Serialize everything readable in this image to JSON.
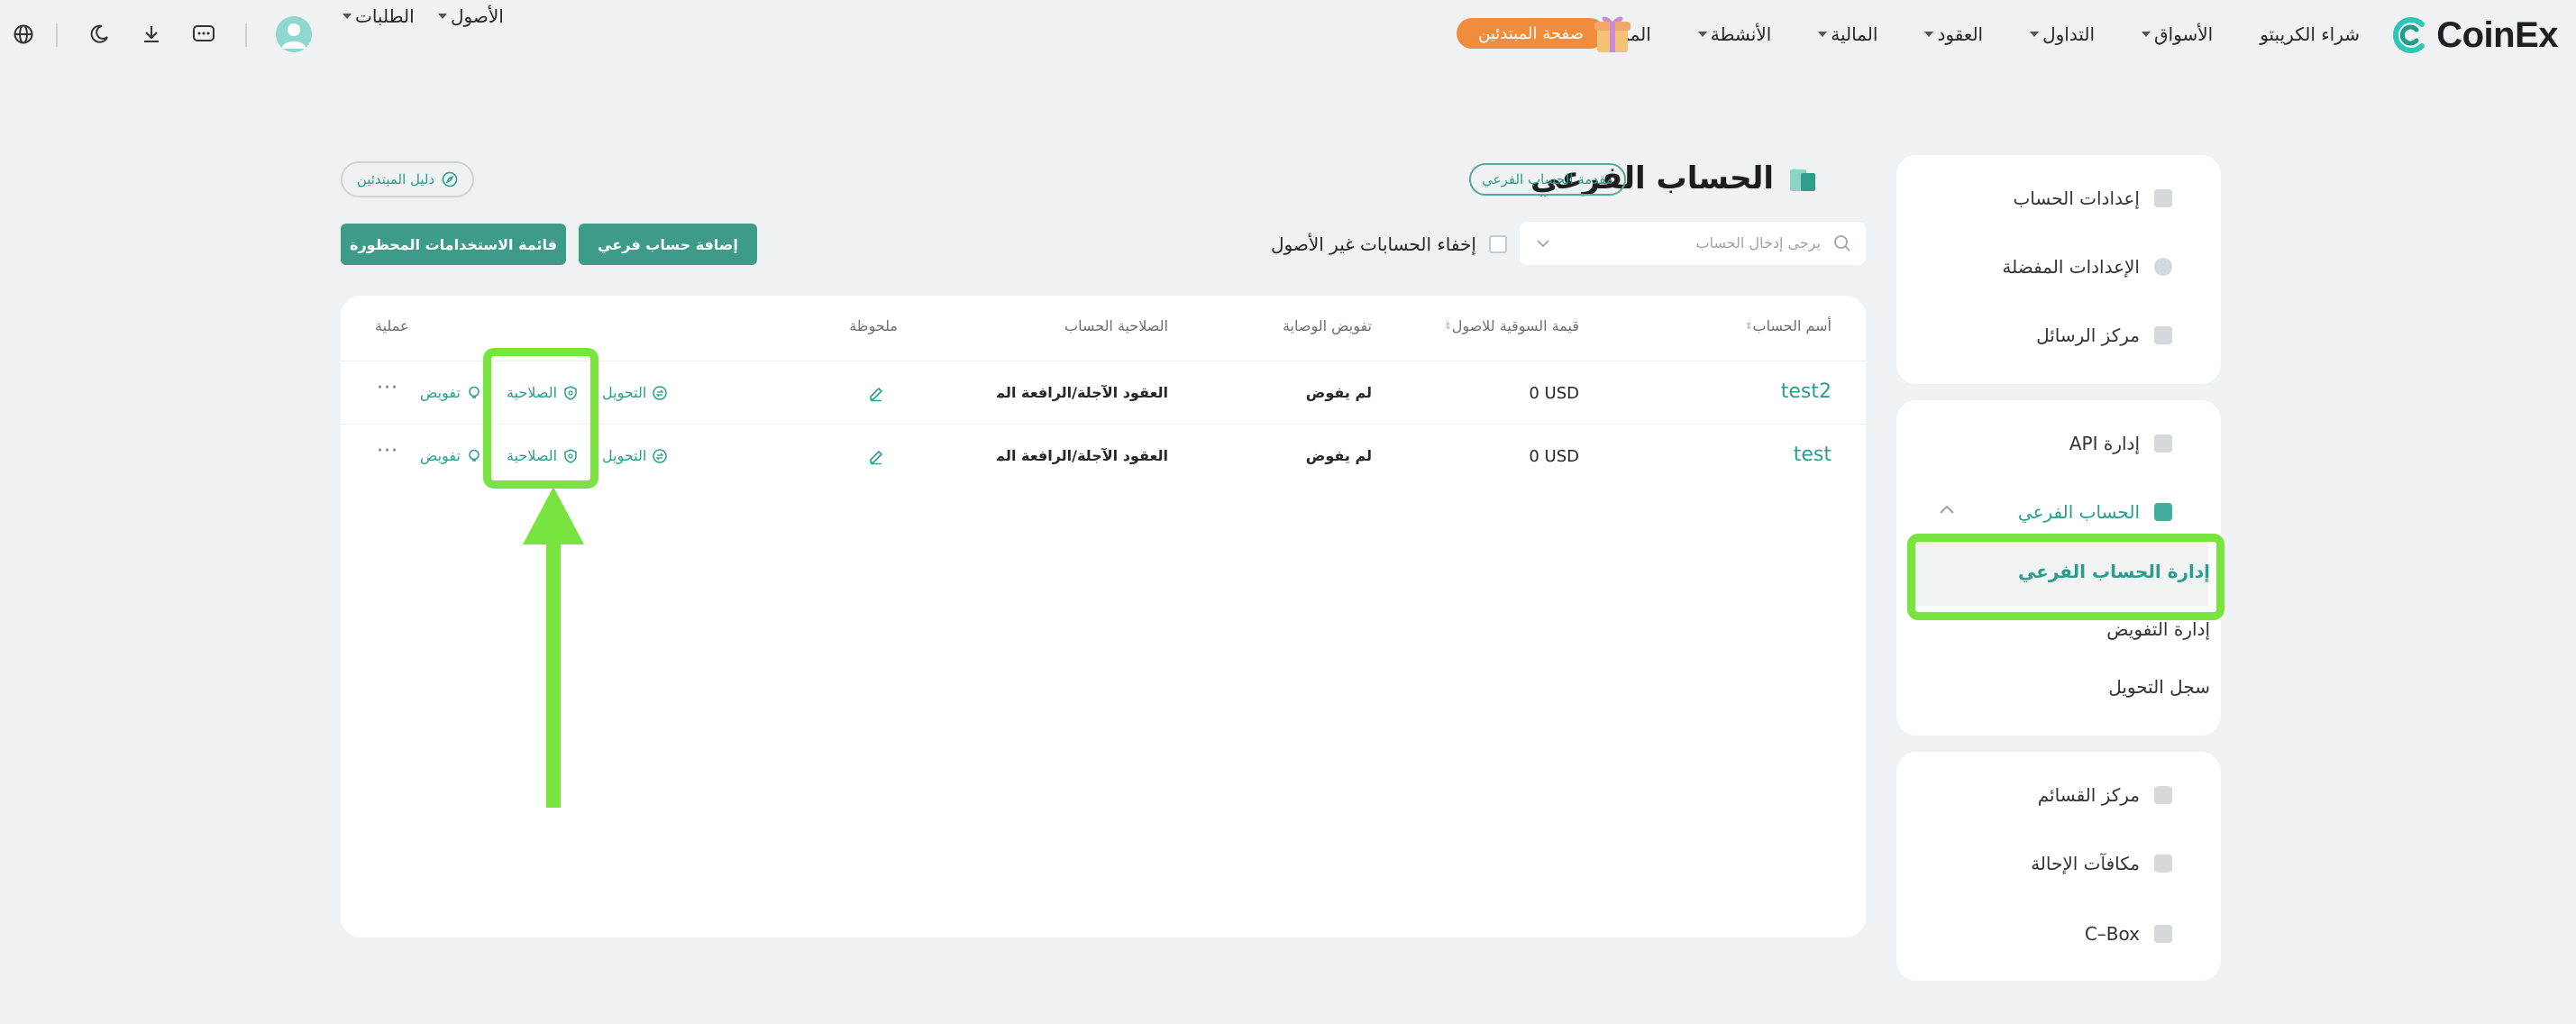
{
  "brand": {
    "name": "CoinEx",
    "color": "#2a9d8f"
  },
  "nav": {
    "items": [
      {
        "label": "شراء الكريبتو",
        "dropdown": false
      },
      {
        "label": "الأسواق",
        "dropdown": true
      },
      {
        "label": "التداول",
        "dropdown": true
      },
      {
        "label": "العقود",
        "dropdown": true
      },
      {
        "label": "المالية",
        "dropdown": true
      },
      {
        "label": "الأنشطة",
        "dropdown": true
      },
      {
        "label": "المزيد",
        "dropdown": true
      }
    ],
    "beginner_label": "صفحة المبتدئين",
    "assets_label": "الأصول",
    "orders_label": "الطلبات"
  },
  "sidebar": {
    "group1": [
      {
        "label": "إعدادات الحساب",
        "icon": "user-icon"
      },
      {
        "label": "الإعدادات المفضلة",
        "icon": "preferences-icon"
      },
      {
        "label": "مركز الرسائل",
        "icon": "message-icon"
      }
    ],
    "group2": {
      "api": {
        "label": "إدارة API",
        "icon": "api-icon"
      },
      "subaccount": {
        "label": "الحساب الفرعي",
        "icon": "subaccount-icon"
      },
      "subitems": [
        {
          "label": "إدارة الحساب الفرعي",
          "active": true
        },
        {
          "label": "إدارة التفويض",
          "active": false
        },
        {
          "label": "سجل التحويل",
          "active": false
        }
      ]
    },
    "group3": [
      {
        "label": "مركز القسائم",
        "icon": "coupon-icon"
      },
      {
        "label": "مكافآت الإحالة",
        "icon": "referral-icon"
      },
      {
        "label": "C–Box",
        "icon": "cbox-icon"
      }
    ]
  },
  "page": {
    "title": "الحساب الفرعي",
    "intro_label": "مقدمة الحساب الفرعي",
    "guide_label": "دليل المبتدئين",
    "search_placeholder": "يرجى إدخال الحساب",
    "hide_label": "إخفاء الحسابات غير الأصول",
    "add_button": "إضافة حساب فرعي",
    "banned_button": "قائمة الاستخدامات المحظورة"
  },
  "table": {
    "headers": {
      "name": "أسم الحساب",
      "value": "قيمة السوقية للاصول",
      "custody": "تفويض الوصاية",
      "permission": "الصلاحية الحساب",
      "note": "ملحوظة",
      "operation": "عملية"
    },
    "rows": [
      {
        "name": "test2",
        "value": "0 USD",
        "custody": "لم يفوض",
        "permission": "العقود الآجلة/الرافعة المالية/ا...",
        "transfer": "التحويل",
        "perm": "الصلاحية",
        "auth": "تفويض",
        "more": "···"
      },
      {
        "name": "test",
        "value": "0 USD",
        "custody": "لم يفوض",
        "permission": "العقود الآجلة/الرافعة المالية/ا...",
        "transfer": "التحويل",
        "perm": "الصلاحية",
        "auth": "تفويض",
        "more": "···"
      }
    ]
  },
  "annotation_color": "#78e43f"
}
